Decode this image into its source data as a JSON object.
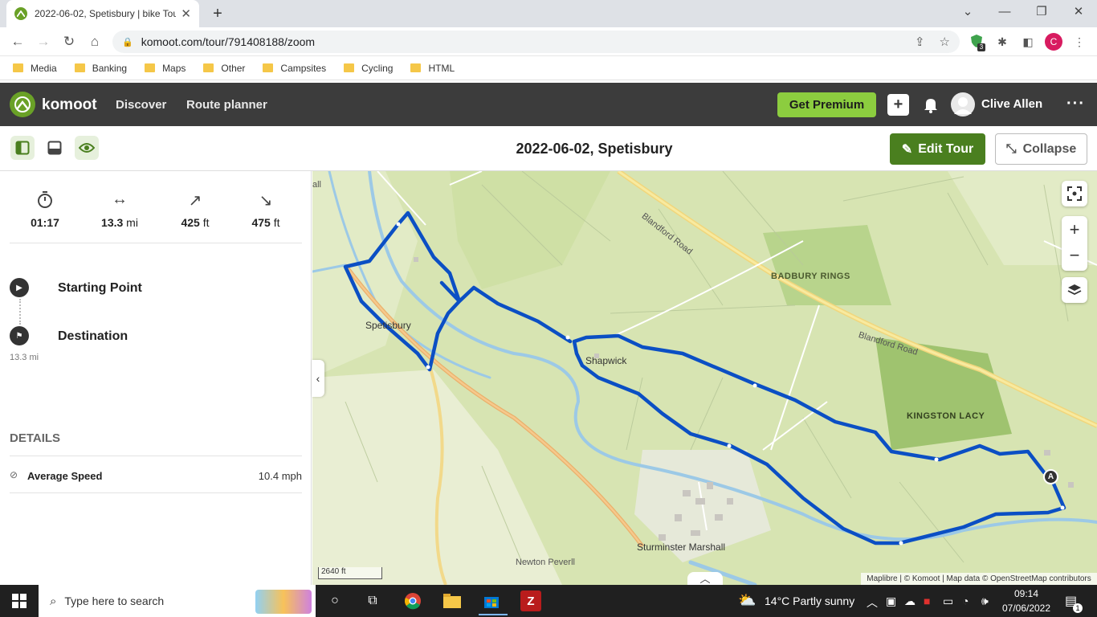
{
  "browser": {
    "tab_title": "2022-06-02, Spetisbury | bike Tou",
    "url": "komoot.com/tour/791408188/zoom",
    "ext_badge": "3",
    "profile_letter": "C",
    "bookmarks": [
      "Media",
      "Banking",
      "Maps",
      "Other",
      "Campsites",
      "Cycling",
      "HTML"
    ]
  },
  "header": {
    "brand": "komoot",
    "nav": [
      "Discover",
      "Route planner"
    ],
    "premium": "Get Premium",
    "user": "Clive Allen"
  },
  "tour": {
    "title": "2022-06-02, Spetisbury",
    "edit": "Edit Tour",
    "collapse": "Collapse"
  },
  "stats": [
    {
      "icon": "stopwatch-icon",
      "value": "01:17",
      "unit": ""
    },
    {
      "icon": "distance-icon",
      "value": "13.3",
      "unit": "mi"
    },
    {
      "icon": "uphill-icon",
      "value": "425",
      "unit": "ft"
    },
    {
      "icon": "downhill-icon",
      "value": "475",
      "unit": "ft"
    }
  ],
  "waypoints": {
    "start": "Starting Point",
    "end": "Destination",
    "distance": "13.3 mi"
  },
  "details": {
    "heading": "DETAILS",
    "avg_label": "Average Speed",
    "avg_value": "10.4 mph"
  },
  "map": {
    "labels": {
      "spetisbury": "Spetisbury",
      "shapwick": "Shapwick",
      "badbury": "BADBURY RINGS",
      "kingston": "KINGSTON LACY",
      "sturminster": "Sturminster Marshall",
      "newton": "Newton Peverll",
      "road1": "Blandford Road",
      "road2": "Blandford Road",
      "corner": "all"
    },
    "start_marker": "A",
    "scale": "2640 ft",
    "attribution": "Maplibre | © Komoot | Map data © OpenStreetMap contributors",
    "route_color": "#0b4fc4"
  },
  "taskbar": {
    "search_placeholder": "Type here to search",
    "weather": "14°C  Partly sunny",
    "time": "09:14",
    "date": "07/06/2022",
    "notif_count": "1"
  }
}
